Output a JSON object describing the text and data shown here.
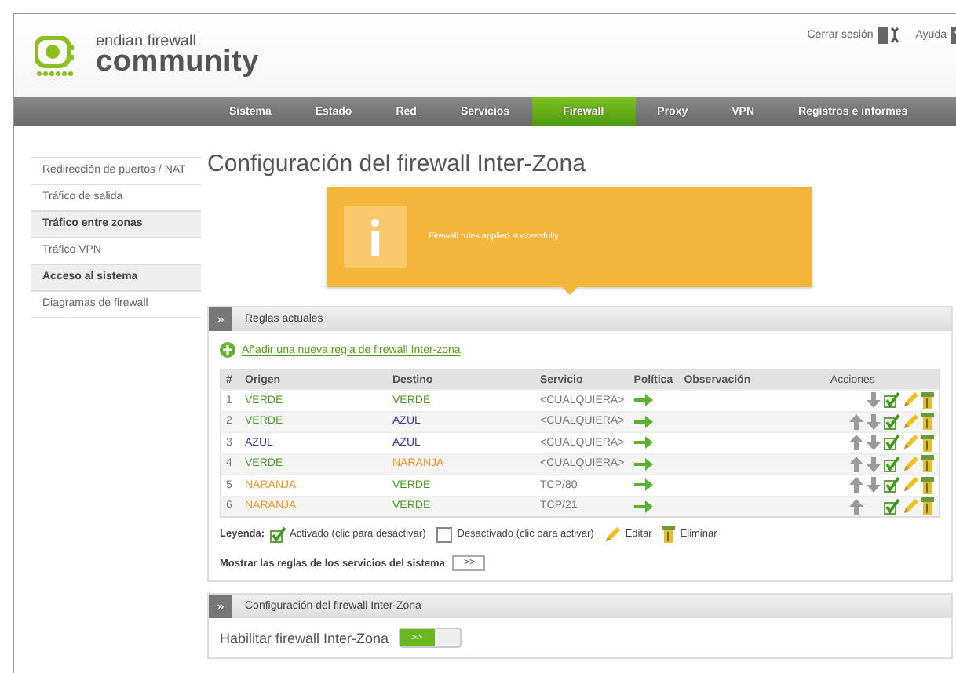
{
  "header": {
    "logo_top": "endian firewall",
    "logo_bottom": "community",
    "links": [
      {
        "label": "Cerrar sesión",
        "kind": "logout"
      },
      {
        "label": "Ayuda",
        "kind": "help"
      }
    ]
  },
  "nav": [
    {
      "label": "Sistema",
      "selected": false
    },
    {
      "label": "Estado",
      "selected": false
    },
    {
      "label": "Red",
      "selected": false
    },
    {
      "label": "Servicios",
      "selected": false
    },
    {
      "label": "Firewall",
      "selected": true
    },
    {
      "label": "Proxy",
      "selected": false
    },
    {
      "label": "VPN",
      "selected": false
    },
    {
      "label": "Registros e informes",
      "selected": false
    }
  ],
  "sidebar": {
    "items": [
      {
        "label": "Redirección de puertos / NAT",
        "selected": false
      },
      {
        "label": "Tráfico de salida",
        "selected": false
      },
      {
        "label": "Tráfico entre zonas",
        "selected": true
      },
      {
        "label": "Tráfico VPN",
        "selected": false
      },
      {
        "label": "Acceso al sistema",
        "selected": true
      },
      {
        "label": "Diagramas de firewall",
        "selected": false
      }
    ]
  },
  "page_title": "Configuración del firewall Inter-Zona",
  "notification": {
    "message": "Firewall rules applied successfully"
  },
  "rules_panel": {
    "title": "Reglas actuales",
    "toggle": "»",
    "add_link": "Añadir una nueva regla de firewall Inter-zona",
    "table": {
      "columns": [
        "#",
        "Origen",
        "Destino",
        "Servicio",
        "Política",
        "Observación",
        "Acciones"
      ],
      "rows": [
        {
          "number": "1",
          "origin": {
            "text": "VERDE",
            "color": "#4c9a2a"
          },
          "destination": {
            "text": "VERDE",
            "color": "#4c9a2a"
          },
          "service": "<CUALQUIERA>",
          "accept": true,
          "can_move_up": false,
          "can_move_down": true,
          "enabled": true
        },
        {
          "number": "2",
          "origin": {
            "text": "VERDE",
            "color": "#4c9a2a"
          },
          "destination": {
            "text": "AZUL",
            "color": "#3a3aa0"
          },
          "service": "<CUALQUIERA>",
          "accept": true,
          "can_move_up": true,
          "can_move_down": true,
          "enabled": true
        },
        {
          "number": "3",
          "origin": {
            "text": "AZUL",
            "color": "#3a3aa0"
          },
          "destination": {
            "text": "AZUL",
            "color": "#3a3aa0"
          },
          "service": "<CUALQUIERA>",
          "accept": true,
          "can_move_up": true,
          "can_move_down": true,
          "enabled": true
        },
        {
          "number": "4",
          "origin": {
            "text": "VERDE",
            "color": "#4c9a2a"
          },
          "destination": {
            "text": "NARANJA",
            "color": "#f0962a"
          },
          "service": "<CUALQUIERA>",
          "accept": true,
          "can_move_up": true,
          "can_move_down": true,
          "enabled": true
        },
        {
          "number": "5",
          "origin": {
            "text": "NARANJA",
            "color": "#f0962a"
          },
          "destination": {
            "text": "VERDE",
            "color": "#4c9a2a"
          },
          "service": "TCP/80",
          "accept": true,
          "can_move_up": true,
          "can_move_down": true,
          "enabled": true
        },
        {
          "number": "6",
          "origin": {
            "text": "NARANJA",
            "color": "#f0962a"
          },
          "destination": {
            "text": "VERDE",
            "color": "#4c9a2a"
          },
          "service": "TCP/21",
          "accept": true,
          "can_move_up": true,
          "can_move_down": false,
          "enabled": true
        }
      ]
    },
    "legend": {
      "label": "Leyenda:",
      "items": [
        {
          "kind": "enabled",
          "text": "Activado (clic para desactivar)"
        },
        {
          "kind": "disabled",
          "text": "Desactivado (clic para activar)"
        },
        {
          "kind": "edit",
          "text": "Editar"
        },
        {
          "kind": "delete",
          "text": "Eliminar"
        }
      ]
    },
    "show_system": {
      "label": "Mostrar las reglas de los servicios del sistema",
      "button": ">>"
    }
  },
  "config_panel": {
    "title": "Configuración del firewall Inter-Zona",
    "toggle": "»",
    "enable_label": "Habilitar firewall Inter-Zona",
    "switch": {
      "label": ">>",
      "on": true
    }
  }
}
